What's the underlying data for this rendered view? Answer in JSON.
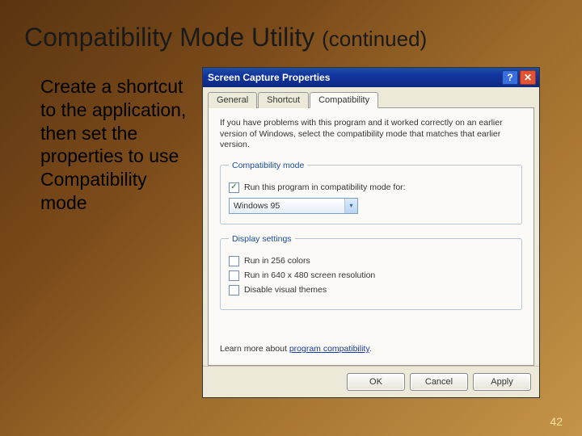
{
  "slide": {
    "title_main": "Compatibility Mode Utility ",
    "title_cont": "(continued)",
    "body": "Create a shortcut to the application, then set the properties to use Compatibility mode",
    "page_number": "42"
  },
  "dialog": {
    "title": "Screen Capture Properties",
    "help_glyph": "?",
    "close_glyph": "✕",
    "tabs": {
      "general": "General",
      "shortcut": "Shortcut",
      "compatibility": "Compatibility"
    },
    "intro": "If you have problems with this program and it worked correctly on an earlier version of Windows, select the compatibility mode that matches that earlier version.",
    "group_compat": {
      "legend": "Compatibility mode",
      "checkbox_label": "Run this program in compatibility mode for:",
      "checkbox_checked_glyph": "✓",
      "combo_value": "Windows 95",
      "combo_arrow": "▾"
    },
    "group_display": {
      "legend": "Display settings",
      "opt_256": "Run in 256 colors",
      "opt_640": "Run in 640 x 480 screen resolution",
      "opt_themes": "Disable visual themes"
    },
    "learn_prefix": "Learn more about ",
    "learn_link": "program compatibility",
    "learn_suffix": ".",
    "buttons": {
      "ok": "OK",
      "cancel": "Cancel",
      "apply": "Apply"
    }
  }
}
